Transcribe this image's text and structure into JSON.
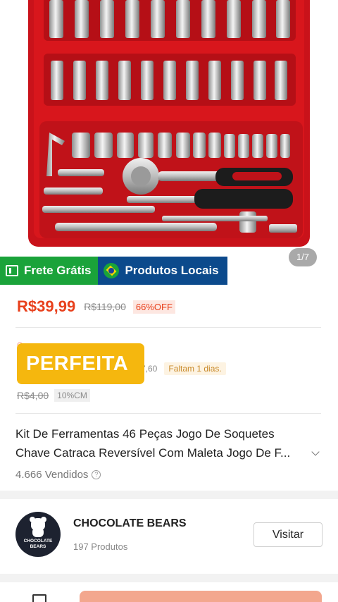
{
  "image": {
    "counter": "1/7"
  },
  "badges": {
    "frete": "Frete Grátis",
    "locais": "Produtos Locais"
  },
  "price": {
    "current": "R$39,99",
    "original": "R$119,00",
    "discount": "66%OFF"
  },
  "coupon": {
    "value_fragment": "7,60",
    "days_left": "Faltam 1 dias.",
    "old": "R$4,00",
    "pct": "10%CM"
  },
  "overlay_label": "PERFEITA",
  "product": {
    "title_line1": "Kit De Ferramentas 46 Peças Jogo De Soquetes",
    "title_line2": "Chave Catraca Reversível Com Maleta Jogo De F...",
    "sold": "4.666 Vendidos"
  },
  "store": {
    "name": "CHOCOLATE BEARS",
    "products": "197 Produtos",
    "logo_text": "CHOCOLATE BEARS",
    "visit_label": "Visitar"
  },
  "colors": {
    "price_red": "#e8401c",
    "frete_green": "#1aa33a",
    "locais_blue": "#0c4a8c",
    "overlay_yellow": "#f5b70e",
    "case_red": "#d8161c"
  }
}
